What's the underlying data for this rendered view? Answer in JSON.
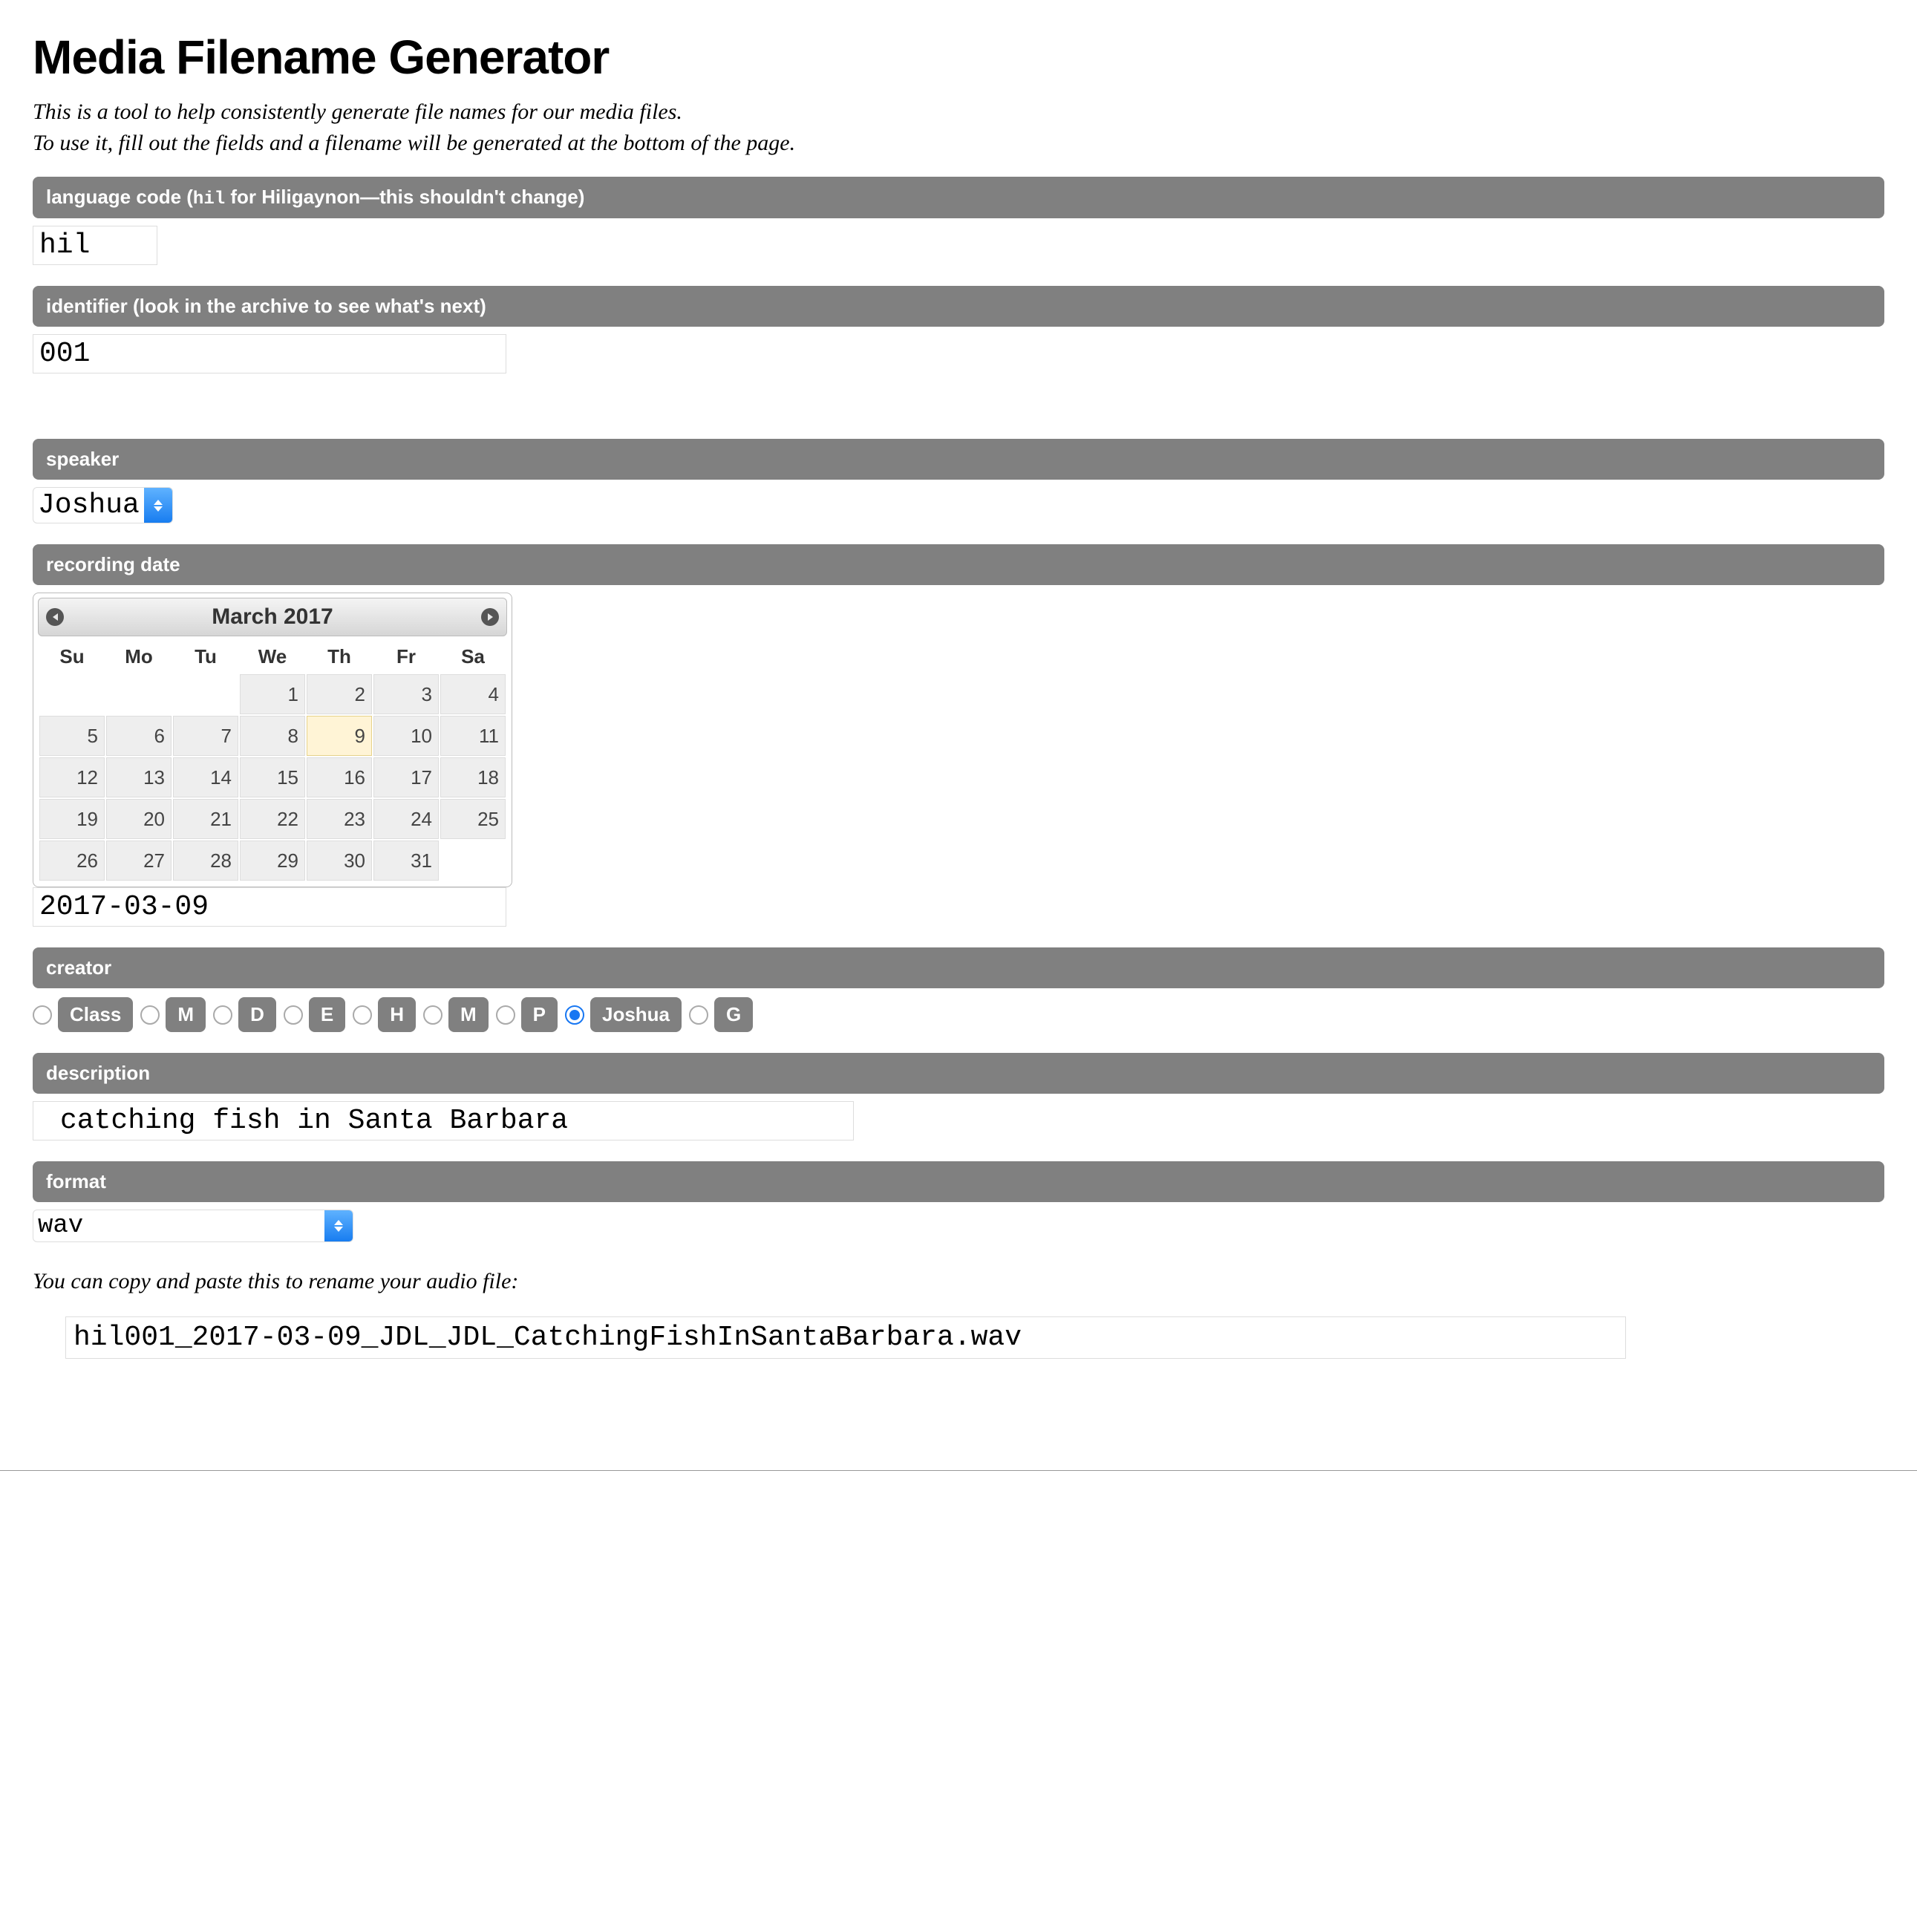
{
  "title": "Media Filename Generator",
  "intro1": "This is a tool to help consistently generate file names for our media files.",
  "intro2": "To use it, fill out the fields and a filename will be generated at the bottom of the page.",
  "sections": {
    "language": {
      "label_pre": "language code (",
      "label_code": "hil",
      "label_post": " for Hiligaynon—this shouldn't change)",
      "value": "hil"
    },
    "identifier": {
      "label": "identifier (look in the archive to see what's next)",
      "value": "001"
    },
    "speaker": {
      "label": "speaker",
      "value": "Joshua"
    },
    "recording_date": {
      "label": "recording date",
      "value": "2017-03-09"
    },
    "creator": {
      "label": "creator",
      "options": [
        "Class",
        "M",
        "D",
        "E",
        "H",
        "M",
        "P",
        "Joshua",
        "G"
      ],
      "selected_index": 7
    },
    "description": {
      "label": "description",
      "value": "catching fish in Santa Barbara"
    },
    "format": {
      "label": "format",
      "value": "wav"
    }
  },
  "calendar": {
    "title": "March 2017",
    "weekdays": [
      "Su",
      "Mo",
      "Tu",
      "We",
      "Th",
      "Fr",
      "Sa"
    ],
    "weeks": [
      [
        null,
        null,
        null,
        1,
        2,
        3,
        4
      ],
      [
        5,
        6,
        7,
        8,
        9,
        10,
        11
      ],
      [
        12,
        13,
        14,
        15,
        16,
        17,
        18
      ],
      [
        19,
        20,
        21,
        22,
        23,
        24,
        25
      ],
      [
        26,
        27,
        28,
        29,
        30,
        31,
        null
      ]
    ],
    "highlighted_day": 9
  },
  "copy_note": "You can copy and paste this to rename your audio file:",
  "result": "hil001_2017-03-09_JDL_JDL_CatchingFishInSantaBarbara.wav"
}
